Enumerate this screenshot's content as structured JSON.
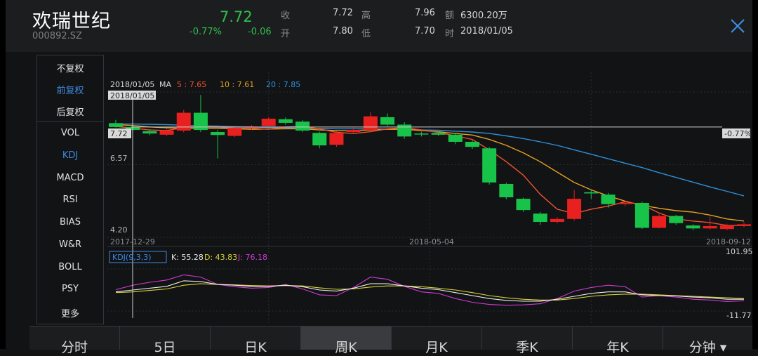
{
  "header": {
    "name": "欢瑞世纪",
    "code": "000892.SZ",
    "price": "7.72",
    "change_pct": "-0.77%",
    "change": "-0.06",
    "close_label": "收",
    "close_value": "7.72",
    "open_label": "开",
    "open_value": "7.80",
    "high_label": "高",
    "high_value": "7.96",
    "low_label": "低",
    "low_value": "7.70",
    "amount_label": "额",
    "amount_value": "6300.20万",
    "time_label": "时",
    "time_value": "2018/01/05"
  },
  "menu": {
    "items": [
      {
        "label": "不复权",
        "active": false
      },
      {
        "label": "前复权",
        "active": true
      },
      {
        "label": "后复权",
        "active": false
      },
      {
        "label": "VOL",
        "active": false
      },
      {
        "label": "KDJ",
        "active": true
      },
      {
        "label": "MACD",
        "active": false
      },
      {
        "label": "RSI",
        "active": false
      },
      {
        "label": "BIAS",
        "active": false
      },
      {
        "label": "W&R",
        "active": false
      },
      {
        "label": "BOLL",
        "active": false
      },
      {
        "label": "PSY",
        "active": false
      },
      {
        "label": "更多",
        "active": false
      }
    ]
  },
  "tabs": [
    {
      "label": "分时",
      "active": false
    },
    {
      "label": "5日",
      "active": false
    },
    {
      "label": "日K",
      "active": false
    },
    {
      "label": "周K",
      "active": true
    },
    {
      "label": "月K",
      "active": false
    },
    {
      "label": "季K",
      "active": false
    },
    {
      "label": "年K",
      "active": false
    },
    {
      "label": "分钟 ▾",
      "active": false
    }
  ],
  "colors": {
    "up": "#e8201f",
    "down": "#18c34a",
    "ma5": "#f0532d",
    "ma10": "#e5a11f",
    "ma20": "#2f8fd6",
    "k": "#eeeeee",
    "d": "#d9d234",
    "j": "#cf3ad2",
    "accent": "#3d8be2"
  },
  "chart_data": {
    "type": "candlestick",
    "date_label": "2018/01/05",
    "ma_legend": {
      "label": "MA",
      "ma5": "5 : 7.65",
      "ma10": "10 : 7.61",
      "ma20": "20 : 7.85"
    },
    "cursor_date": "2018/01/05",
    "price_cursor": "7.72",
    "cursor_pct": "-0.77%",
    "y_top_label": "6.57",
    "y_bottom_label": "4.20",
    "x_labels": [
      "2017-12-29",
      "2018-05-04",
      "2018-09-12"
    ],
    "ylim": [
      4.0,
      8.9
    ],
    "candles": [
      {
        "o": 7.85,
        "c": 7.72,
        "h": 7.96,
        "l": 7.7
      },
      {
        "o": 7.72,
        "c": 7.62,
        "h": 7.8,
        "l": 7.55
      },
      {
        "o": 7.58,
        "c": 7.5,
        "h": 7.64,
        "l": 7.44
      },
      {
        "o": 7.46,
        "c": 7.6,
        "h": 7.66,
        "l": 7.42
      },
      {
        "o": 7.6,
        "c": 8.2,
        "h": 8.3,
        "l": 7.54
      },
      {
        "o": 8.2,
        "c": 7.62,
        "h": 8.8,
        "l": 7.55
      },
      {
        "o": 7.55,
        "c": 7.45,
        "h": 7.62,
        "l": 6.66
      },
      {
        "o": 7.42,
        "c": 7.68,
        "h": 7.75,
        "l": 7.38
      },
      {
        "o": 7.7,
        "c": 7.72,
        "h": 7.78,
        "l": 7.62
      },
      {
        "o": 7.75,
        "c": 8.0,
        "h": 8.05,
        "l": 7.7
      },
      {
        "o": 7.98,
        "c": 7.86,
        "h": 8.04,
        "l": 7.8
      },
      {
        "o": 7.9,
        "c": 7.6,
        "h": 7.95,
        "l": 7.55
      },
      {
        "o": 7.52,
        "c": 7.1,
        "h": 7.56,
        "l": 7.0
      },
      {
        "o": 7.12,
        "c": 7.52,
        "h": 7.58,
        "l": 7.05
      },
      {
        "o": 7.55,
        "c": 7.62,
        "h": 7.7,
        "l": 7.5
      },
      {
        "o": 7.62,
        "c": 8.08,
        "h": 8.22,
        "l": 7.58
      },
      {
        "o": 8.05,
        "c": 7.8,
        "h": 8.18,
        "l": 7.75
      },
      {
        "o": 7.8,
        "c": 7.4,
        "h": 7.88,
        "l": 7.32
      },
      {
        "o": 7.5,
        "c": 7.48,
        "h": 7.56,
        "l": 7.4
      },
      {
        "o": 7.52,
        "c": 7.46,
        "h": 7.58,
        "l": 7.42
      },
      {
        "o": 7.46,
        "c": 7.22,
        "h": 7.5,
        "l": 7.14
      },
      {
        "o": 7.22,
        "c": 7.05,
        "h": 7.26,
        "l": 6.98
      },
      {
        "o": 7.0,
        "c": 5.85,
        "h": 7.04,
        "l": 5.78
      },
      {
        "o": 5.8,
        "c": 5.35,
        "h": 5.84,
        "l": 5.28
      },
      {
        "o": 5.3,
        "c": 4.92,
        "h": 5.34,
        "l": 4.86
      },
      {
        "o": 4.8,
        "c": 4.52,
        "h": 4.86,
        "l": 4.42
      },
      {
        "o": 4.52,
        "c": 4.62,
        "h": 4.68,
        "l": 4.48
      },
      {
        "o": 4.62,
        "c": 5.3,
        "h": 5.6,
        "l": 4.56
      },
      {
        "o": 5.52,
        "c": 5.48,
        "h": 5.62,
        "l": 5.3
      },
      {
        "o": 5.44,
        "c": 5.12,
        "h": 5.5,
        "l": 5.0
      },
      {
        "o": 5.12,
        "c": 5.16,
        "h": 5.22,
        "l": 5.05
      },
      {
        "o": 5.16,
        "c": 4.32,
        "h": 5.2,
        "l": 4.28
      },
      {
        "o": 4.32,
        "c": 4.72,
        "h": 4.78,
        "l": 4.3
      },
      {
        "o": 4.72,
        "c": 4.48,
        "h": 4.76,
        "l": 4.42
      },
      {
        "o": 4.4,
        "c": 4.3,
        "h": 4.44,
        "l": 4.24
      },
      {
        "o": 4.3,
        "c": 4.38,
        "h": 4.7,
        "l": 4.26
      },
      {
        "o": 4.28,
        "c": 4.4,
        "h": 4.46,
        "l": 4.24
      },
      {
        "o": 4.38,
        "c": 4.44,
        "h": 4.5,
        "l": 4.34
      }
    ],
    "ma5": [
      7.74,
      7.68,
      7.62,
      7.6,
      7.7,
      7.74,
      7.72,
      7.68,
      7.68,
      7.64,
      7.72,
      7.74,
      7.66,
      7.54,
      7.5,
      7.56,
      7.66,
      7.7,
      7.62,
      7.54,
      7.42,
      7.3,
      6.95,
      6.55,
      6.1,
      5.45,
      4.95,
      4.8,
      4.95,
      5.05,
      5.2,
      5.1,
      4.82,
      4.62,
      4.55,
      4.5,
      4.4,
      4.4
    ],
    "ma10": [
      7.8,
      7.77,
      7.72,
      7.69,
      7.68,
      7.68,
      7.68,
      7.66,
      7.64,
      7.65,
      7.66,
      7.66,
      7.62,
      7.6,
      7.6,
      7.62,
      7.64,
      7.64,
      7.6,
      7.56,
      7.5,
      7.45,
      7.3,
      7.1,
      6.85,
      6.55,
      6.2,
      5.85,
      5.6,
      5.4,
      5.22,
      5.08,
      4.98,
      4.9,
      4.85,
      4.75,
      4.62,
      4.55
    ],
    "ma20": [
      7.82,
      7.82,
      7.81,
      7.8,
      7.78,
      7.76,
      7.75,
      7.73,
      7.72,
      7.7,
      7.69,
      7.68,
      7.67,
      7.66,
      7.66,
      7.66,
      7.65,
      7.64,
      7.62,
      7.61,
      7.58,
      7.55,
      7.5,
      7.42,
      7.33,
      7.22,
      7.1,
      6.95,
      6.8,
      6.65,
      6.5,
      6.35,
      6.18,
      6.02,
      5.86,
      5.7,
      5.55,
      5.4
    ],
    "kdj": {
      "label": "KDJ(9,3,3)",
      "k_label": "K: 55.28",
      "d_label": "D: 43.83",
      "j_label": "J: 76.18",
      "top_label": "101.95",
      "bottom_label": "-11.77",
      "ylim": [
        -11.77,
        101.95
      ],
      "k": [
        40,
        45,
        50,
        55,
        70,
        68,
        60,
        58,
        55,
        55,
        58,
        54,
        45,
        42,
        50,
        62,
        62,
        56,
        50,
        46,
        38,
        30,
        22,
        17,
        15,
        15,
        20,
        28,
        36,
        40,
        40,
        32,
        30,
        29,
        26,
        24,
        20,
        20
      ],
      "d": [
        38,
        40,
        44,
        48,
        58,
        62,
        60,
        59,
        57,
        56,
        57,
        56,
        51,
        47,
        48,
        53,
        56,
        56,
        54,
        50,
        45,
        38,
        30,
        24,
        20,
        18,
        18,
        22,
        28,
        32,
        34,
        34,
        32,
        30,
        28,
        26,
        24,
        22
      ],
      "j": [
        46,
        58,
        66,
        72,
        86,
        80,
        60,
        54,
        50,
        52,
        60,
        48,
        32,
        30,
        52,
        80,
        74,
        55,
        40,
        36,
        22,
        12,
        6,
        4,
        5,
        8,
        22,
        42,
        52,
        58,
        54,
        26,
        30,
        26,
        20,
        18,
        14,
        16
      ]
    }
  }
}
